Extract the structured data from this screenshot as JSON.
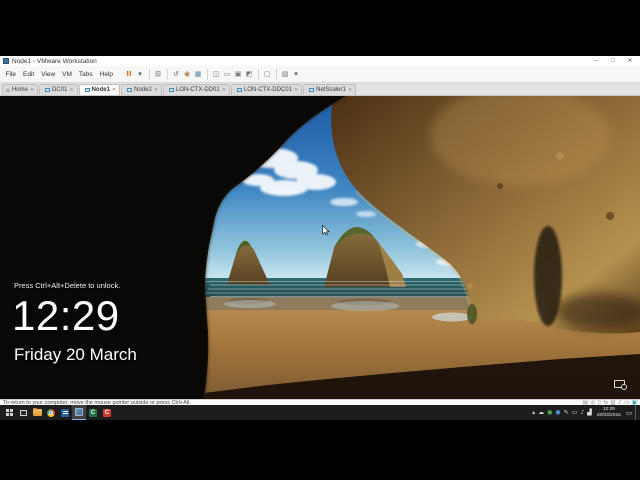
{
  "window": {
    "title": "Node1 - VMware Workstation",
    "controls": {
      "minimize": "–",
      "maximize": "□",
      "close": "✕"
    }
  },
  "menu": {
    "items": [
      "File",
      "Edit",
      "View",
      "VM",
      "Tabs",
      "Help"
    ]
  },
  "toolbar": {
    "power": [
      {
        "name": "suspend-button",
        "glyph": "II",
        "color": "#e07000"
      },
      {
        "name": "power-dropdown-arrow",
        "glyph": "▾",
        "color": "#555555"
      }
    ],
    "ctrl_alt_del": [
      {
        "name": "send-ctrl-alt-del-button",
        "glyph": "⊡",
        "color": "#777777"
      }
    ],
    "snapshots": [
      {
        "name": "revert-snapshot-button",
        "glyph": "↺",
        "color": "#8a8a8a"
      },
      {
        "name": "take-snapshot-button",
        "glyph": "◉",
        "color": "#b07a4a"
      },
      {
        "name": "snapshot-manager-button",
        "glyph": "▦",
        "color": "#5a86a8"
      }
    ],
    "layout": [
      {
        "name": "show-library-button",
        "glyph": "◫",
        "color": "#777777"
      },
      {
        "name": "thumbnail-bar-button",
        "glyph": "▭",
        "color": "#777777"
      },
      {
        "name": "fullscreen-button",
        "glyph": "▣",
        "color": "#777777"
      },
      {
        "name": "unity-mode-button",
        "glyph": "◩",
        "color": "#777777"
      }
    ],
    "console": [
      {
        "name": "console-view-button",
        "glyph": "▢",
        "color": "#777777"
      }
    ],
    "display": [
      {
        "name": "stretch-guest-button",
        "glyph": "▧",
        "color": "#777777"
      },
      {
        "name": "display-dropdown-arrow",
        "glyph": "▾",
        "color": "#555555"
      }
    ]
  },
  "tabs": [
    {
      "label": "Home",
      "type": "home",
      "icon_glyph": "⌂",
      "close": "✕",
      "state": ""
    },
    {
      "label": "DC01",
      "type": "vm",
      "icon_glyph": "",
      "close": "✕",
      "state": ""
    },
    {
      "label": "Node1",
      "type": "vm",
      "icon_glyph": "",
      "close": "✕",
      "state": "active"
    },
    {
      "label": "Node2",
      "type": "vm",
      "icon_glyph": "",
      "close": "✕",
      "state": ""
    },
    {
      "label": "LON-CTX-DD01",
      "type": "vm",
      "icon_glyph": "",
      "close": "✕",
      "state": ""
    },
    {
      "label": "LON-CTX-DDC01",
      "type": "vm",
      "icon_glyph": "",
      "close": "✕",
      "state": ""
    },
    {
      "label": "NetScaler1",
      "type": "vm",
      "icon_glyph": "",
      "close": "✕",
      "state": ""
    }
  ],
  "lock_screen": {
    "unlock_message": "Press Ctrl+Alt+Delete to unlock.",
    "time": "12:29",
    "date": "Friday 20 March"
  },
  "statusbar": {
    "message": "To return to your computer, move the mouse pointer outside or press Ctrl+Alt.",
    "devices": [
      {
        "name": "hard-disk-icon",
        "glyph": "▤",
        "color": "#7a8a94"
      },
      {
        "name": "cd-drive-icon",
        "glyph": "◎",
        "color": "#7a8a94"
      },
      {
        "name": "floppy-icon",
        "glyph": "▯",
        "color": "#7a8a94"
      },
      {
        "name": "network-adapter-icon",
        "glyph": "⇆",
        "color": "#7a8a94"
      },
      {
        "name": "usb-icon",
        "glyph": "▥",
        "color": "#7a8a94"
      },
      {
        "name": "sound-icon",
        "glyph": "♪",
        "color": "#7a8a94"
      },
      {
        "name": "printer-icon",
        "glyph": "▭",
        "color": "#7a8a94"
      },
      {
        "name": "message-log-icon",
        "glyph": "▣",
        "color": "#2fa3ad"
      }
    ]
  },
  "taskbar": {
    "apps": {
      "green_letter": "C",
      "red_letter": "C"
    },
    "tray": [
      {
        "name": "show-hidden-icons-chevron",
        "glyph": "▴",
        "color": "#cfcfcf"
      },
      {
        "name": "onedrive-cloud-icon",
        "glyph": "☁",
        "color": "#cfcfcf"
      },
      {
        "name": "green-status-tray-icon",
        "glyph": "●",
        "color": "#43a047"
      },
      {
        "name": "blue-status-tray-icon",
        "glyph": "●",
        "color": "#4a86c8"
      },
      {
        "name": "pen-tray-icon",
        "glyph": "✎",
        "color": "#dddddd"
      },
      {
        "name": "touch-keyboard-icon",
        "glyph": "▭",
        "color": "#dddddd"
      },
      {
        "name": "volume-icon",
        "glyph": "♪",
        "color": "#dddddd"
      },
      {
        "name": "network-tray-icon",
        "glyph": "▟",
        "color": "#dddddd"
      }
    ],
    "clock": {
      "time": "12:29",
      "date": "20/03/2015"
    },
    "action_center_glyph": "▭"
  },
  "colors": {
    "sky_top": "#1b5aa6",
    "sky_horizon": "#cfe9f2",
    "sea": "#1d454c",
    "sand": "#a0733c",
    "cave_rock": "#0a0806",
    "lit_rock": "#8a6636",
    "pause_orange": "#e07000",
    "taskbar_bg": "#1d1d1d",
    "active_app_underline": "#76b9ed"
  }
}
